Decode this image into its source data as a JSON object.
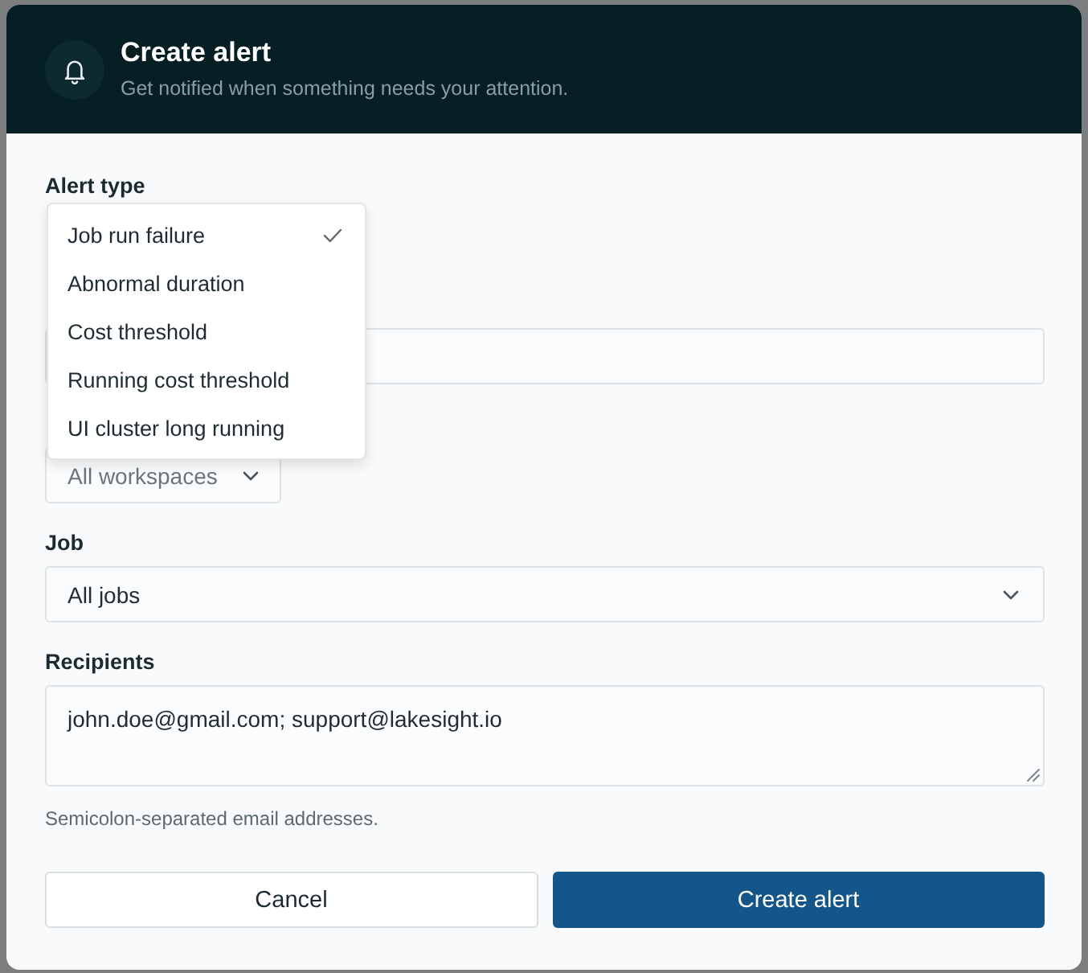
{
  "header": {
    "title": "Create alert",
    "subtitle": "Get notified when something needs your attention."
  },
  "alert_type": {
    "label": "Alert type",
    "options": [
      {
        "label": "Job run failure",
        "selected": true
      },
      {
        "label": "Abnormal duration",
        "selected": false
      },
      {
        "label": "Cost threshold",
        "selected": false
      },
      {
        "label": "Running cost threshold",
        "selected": false
      },
      {
        "label": "UI cluster long running",
        "selected": false
      }
    ]
  },
  "fields": [
    {
      "kind": "text"
    },
    {
      "kind": "compact-select",
      "value": "All workspaces"
    },
    {
      "kind": "select",
      "label": "Job",
      "value": "All jobs"
    },
    {
      "kind": "textarea",
      "label": "Recipients",
      "value": "john.doe@gmail.com; support@lakesight.io",
      "hint": "Semicolon-separated email addresses."
    }
  ],
  "buttons": [
    {
      "kind": "secondary",
      "label": "Cancel"
    },
    {
      "kind": "primary",
      "label": "Create alert"
    }
  ]
}
